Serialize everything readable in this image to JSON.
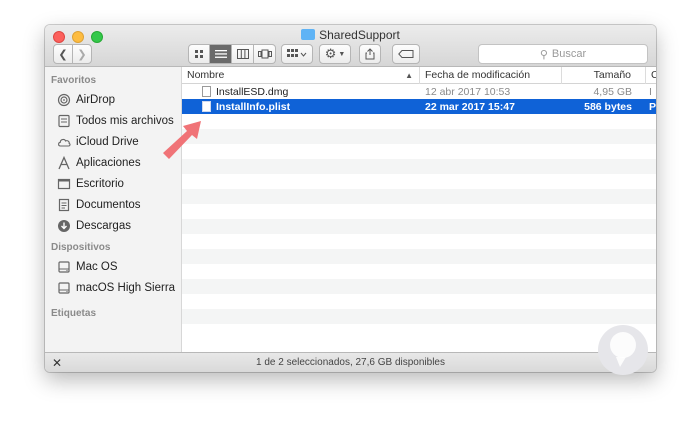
{
  "window": {
    "title": "SharedSupport",
    "search_placeholder": "Buscar"
  },
  "toolbar": {
    "icons": [
      "chevron-left-icon",
      "chevron-right-icon",
      "icon-view-icon",
      "list-view-icon",
      "column-view-icon",
      "cover-flow-icon",
      "arrange-icon",
      "gear-icon",
      "share-icon",
      "tag-icon",
      "search-icon"
    ]
  },
  "sidebar": {
    "sections": [
      {
        "title": "Favoritos",
        "items": [
          {
            "label": "AirDrop",
            "icon": "airdrop-icon"
          },
          {
            "label": "Todos mis archivos",
            "icon": "all-files-icon"
          },
          {
            "label": "iCloud Drive",
            "icon": "cloud-icon"
          },
          {
            "label": "Aplicaciones",
            "icon": "applications-icon"
          },
          {
            "label": "Escritorio",
            "icon": "desktop-icon"
          },
          {
            "label": "Documentos",
            "icon": "document-icon"
          },
          {
            "label": "Descargas",
            "icon": "download-icon"
          }
        ]
      },
      {
        "title": "Dispositivos",
        "items": [
          {
            "label": "Mac OS",
            "icon": "disk-icon"
          },
          {
            "label": "macOS High Sierra",
            "icon": "disk-icon"
          }
        ]
      },
      {
        "title": "Etiquetas",
        "items": []
      }
    ]
  },
  "columns": {
    "name": "Nombre",
    "date": "Fecha de modificación",
    "size": "Tamaño",
    "kind": "C"
  },
  "files": [
    {
      "name": "InstallESD.dmg",
      "date": "12 abr 2017 10:53",
      "size": "4,95 GB",
      "kind": "I",
      "selected": false
    },
    {
      "name": "InstallInfo.plist",
      "date": "22 mar 2017 15:47",
      "size": "586 bytes",
      "kind": "P",
      "selected": true
    }
  ],
  "status": {
    "text": "1 de 2 seleccionados, 27,6 GB disponibles"
  },
  "colors": {
    "selection": "#0f62d7",
    "arrow": "#f07377",
    "watermark": "#e6e6ea"
  }
}
